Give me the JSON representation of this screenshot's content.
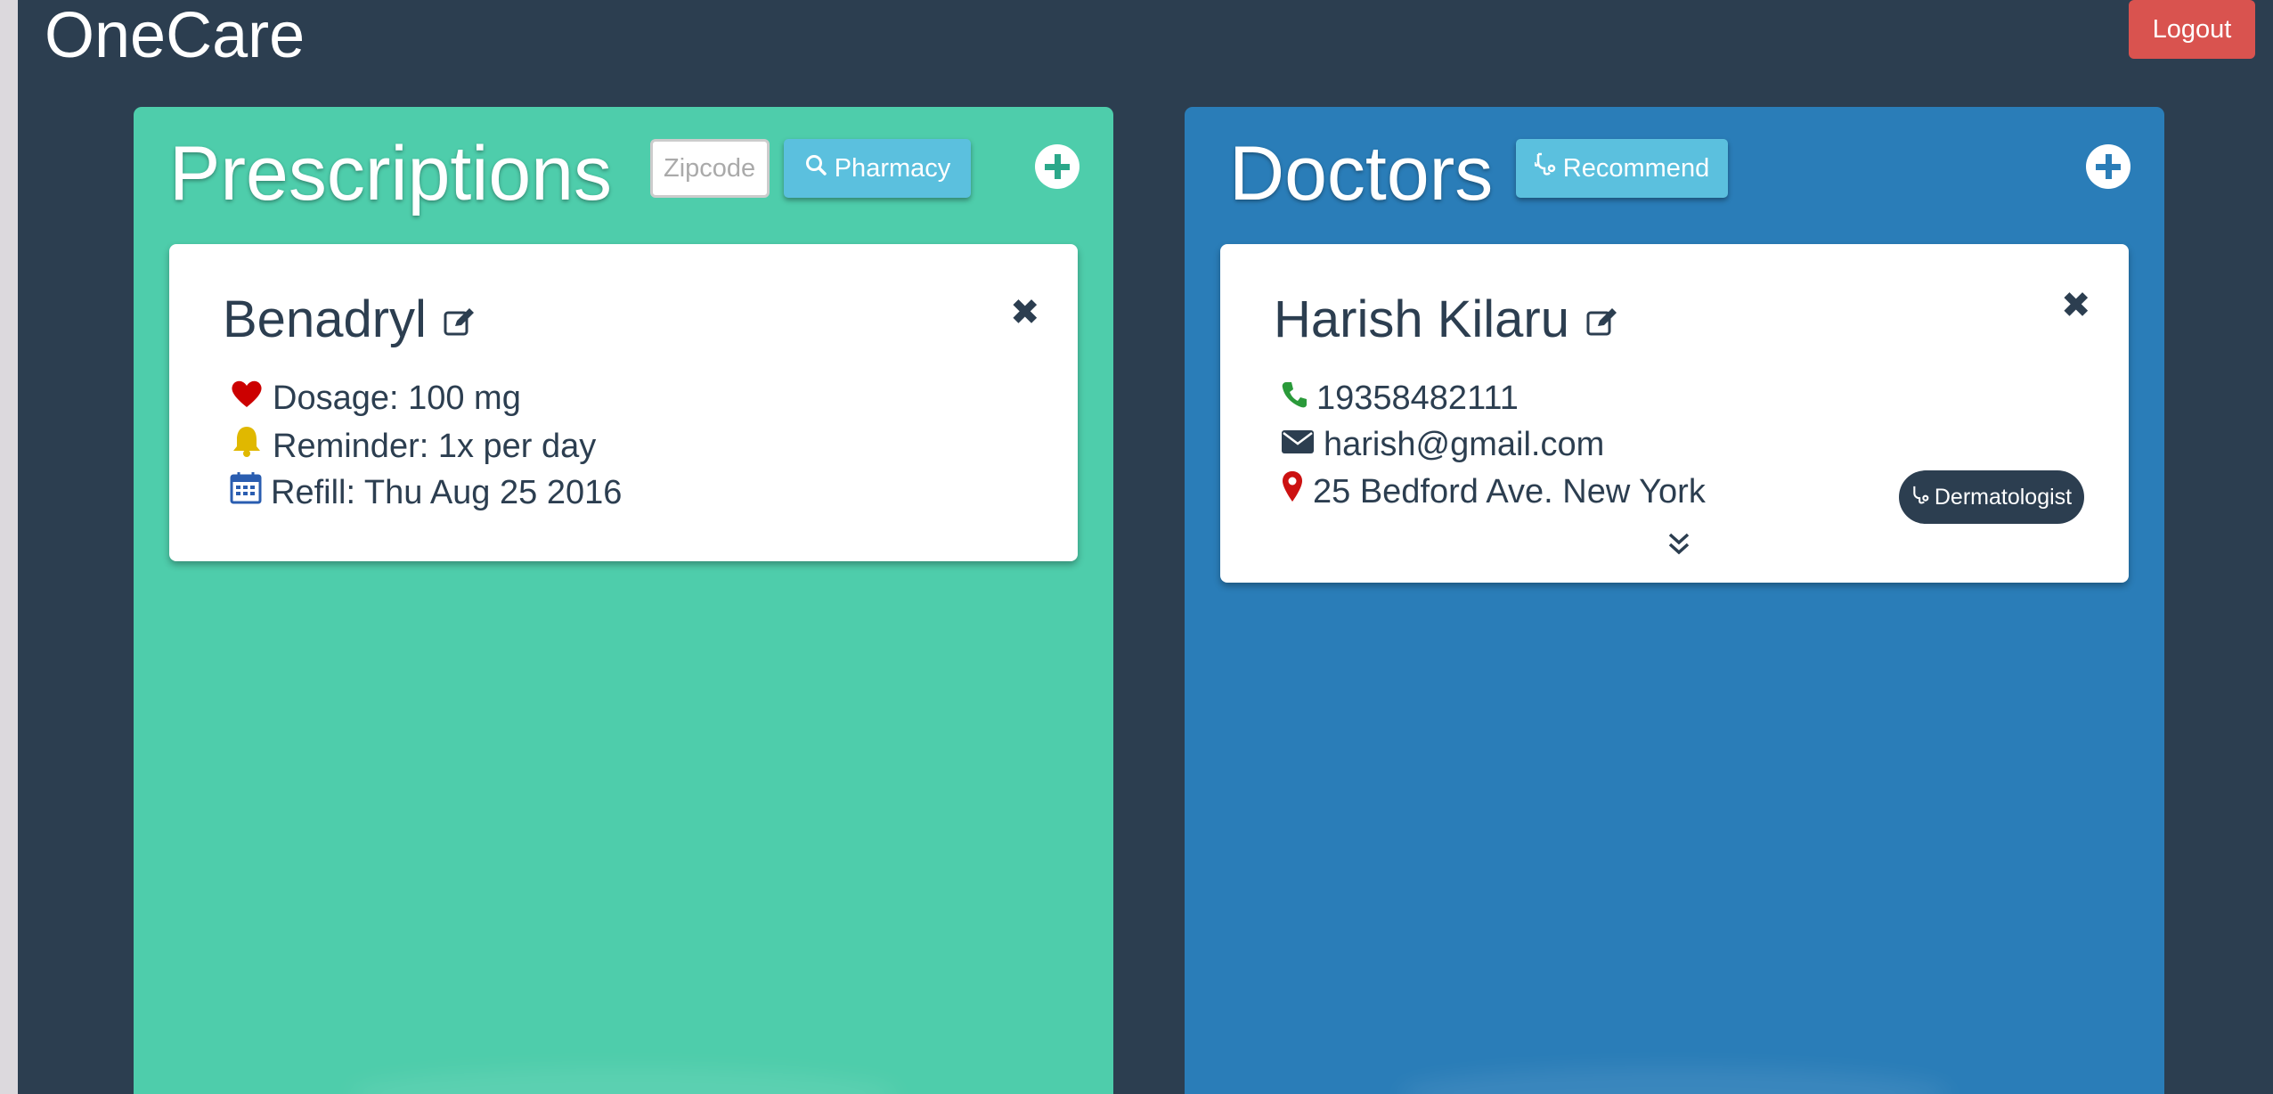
{
  "app": {
    "title": "OneCare",
    "logout_label": "Logout"
  },
  "prescriptions": {
    "title": "Prescriptions",
    "zip_placeholder": "Zipcode",
    "pharmacy_label": "Pharmacy",
    "cards": [
      {
        "name": "Benadryl",
        "dosage": "Dosage: 100 mg",
        "reminder": "Reminder: 1x per day",
        "refill": "Refill: Thu Aug 25 2016"
      }
    ]
  },
  "doctors": {
    "title": "Doctors",
    "recommend_label": "Recommend",
    "cards": [
      {
        "name": "Harish Kilaru",
        "phone": "19358482111",
        "email": "harish@gmail.com",
        "address": "25 Bedford Ave. New York",
        "specialty": "Dermatologist"
      }
    ]
  },
  "colors": {
    "background": "#2c3e50",
    "prescriptions_panel": "#4ecdab",
    "doctors_panel": "#2a7db8",
    "logout": "#d9534f",
    "info_button": "#5bc0de"
  },
  "icons": {
    "add_prescription": "plus-circle-icon",
    "add_doctor": "plus-circle-icon",
    "dosage": "heart-icon",
    "reminder": "bell-icon",
    "refill": "calendar-icon",
    "phone": "phone-icon",
    "email": "envelope-icon",
    "address": "map-marker-icon"
  }
}
